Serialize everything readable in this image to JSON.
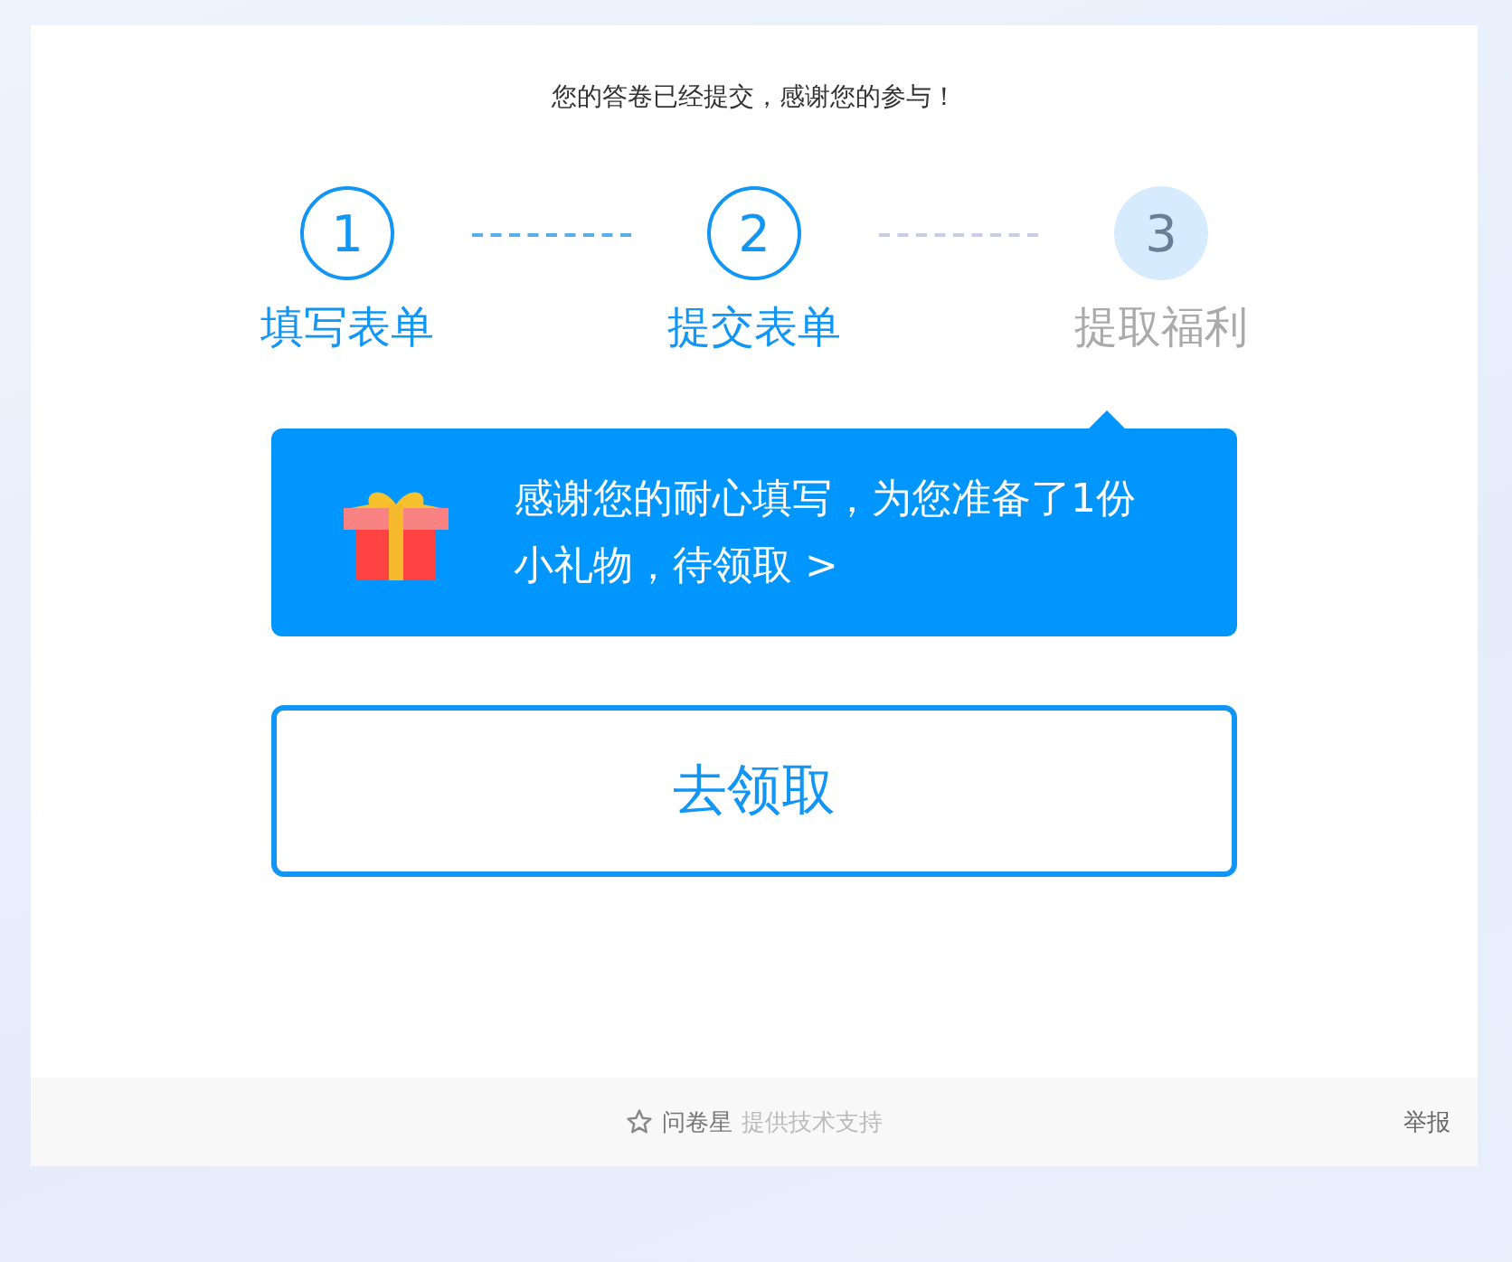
{
  "message": "您的答卷已经提交，感谢您的参与！",
  "steps": [
    {
      "number": "1",
      "label": "填写表单",
      "done": true
    },
    {
      "number": "2",
      "label": "提交表单",
      "done": true
    },
    {
      "number": "3",
      "label": "提取福利",
      "done": false
    }
  ],
  "banner": {
    "text": "感谢您的耐心填写，为您准备了1份小礼物，待领取 >"
  },
  "claim_button": "去领取",
  "footer": {
    "brand": "问卷星",
    "support": "提供技术支持",
    "report": "举报"
  }
}
